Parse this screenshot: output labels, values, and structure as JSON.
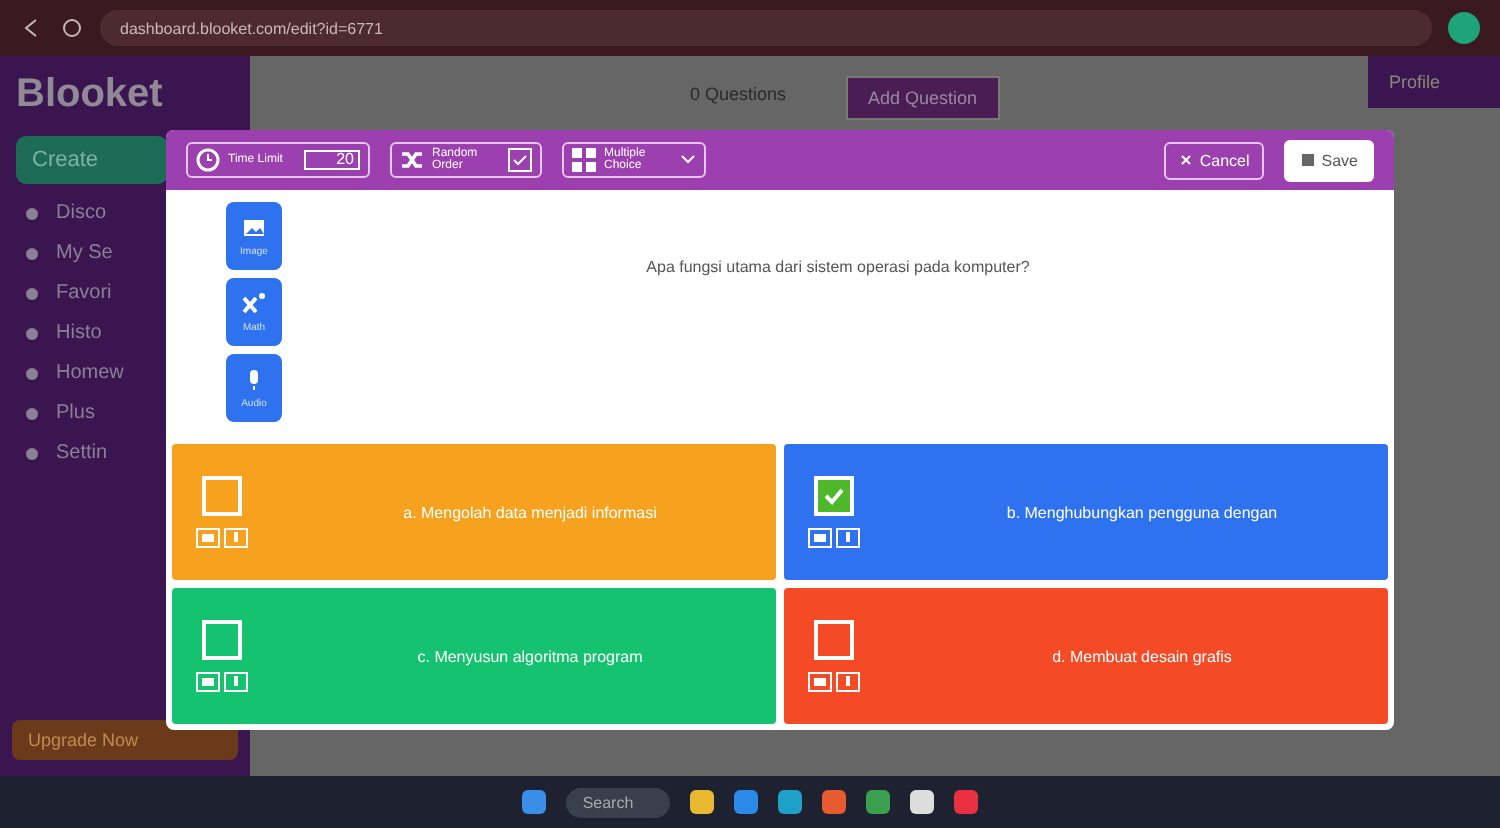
{
  "browser": {
    "url": "dashboard.blooket.com/edit?id=6771"
  },
  "sidebar": {
    "logo": "Blooket",
    "create": "Create",
    "items": [
      "Disco",
      "My Se",
      "Favori",
      "Histo",
      "Homew",
      "Plus",
      "Settin"
    ],
    "upgrade": "Upgrade Now"
  },
  "background": {
    "count": "0 Questions",
    "add_button": "Add Question",
    "profile": "Profile"
  },
  "toolbar": {
    "time_label": "Time Limit",
    "time_value": "20",
    "random_label": "Random Order",
    "random_checked": true,
    "type_label": "Multiple Choice",
    "cancel": "Cancel",
    "save": "Save"
  },
  "media_buttons": [
    {
      "kind": "image",
      "label": "Image"
    },
    {
      "kind": "math",
      "label": "Math"
    },
    {
      "kind": "audio",
      "label": "Audio"
    }
  ],
  "question": "Apa fungsi utama dari sistem operasi pada komputer?",
  "answers": [
    {
      "text": "a. Mengolah data menjadi informasi",
      "color": "#f6a21e",
      "checked": false
    },
    {
      "text": "b. Menghubungkan pengguna dengan",
      "color": "#2f72f0",
      "checked": true
    },
    {
      "text": "c. Menyusun algoritma program",
      "color": "#14c26f",
      "checked": false
    },
    {
      "text": "d. Membuat desain grafis",
      "color": "#f54a26",
      "checked": false
    }
  ],
  "taskbar": {
    "search": "Search"
  }
}
